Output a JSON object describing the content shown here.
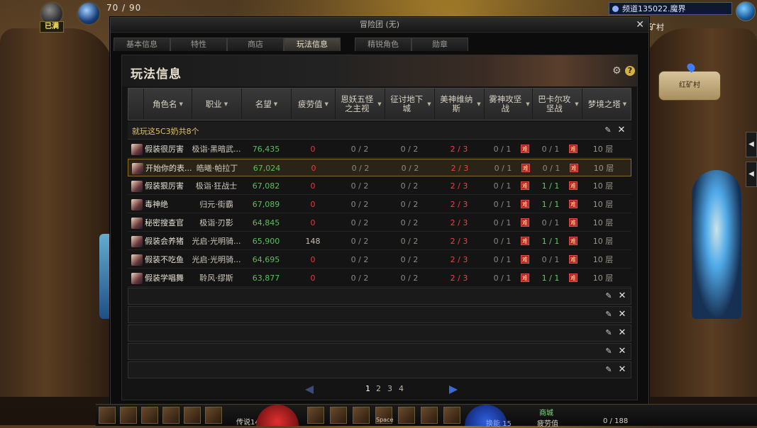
{
  "hud": {
    "status_label": "已满",
    "hp_text": "70 / 90",
    "channel": "频道135022.魔界",
    "town": "矿村",
    "minimap_label": "红矿村",
    "bottom": {
      "legend_label": "传说14",
      "stamina_label": "疲劳值",
      "stamina_value": "0 / 188",
      "swap_label": "换能",
      "swap_value": "15",
      "mall_label": "商城",
      "space_label": "Space"
    }
  },
  "dialog": {
    "title": "冒险团 (无)",
    "tabs": [
      "基本信息",
      "特性",
      "商店",
      "玩法信息",
      "精锐角色",
      "勋章"
    ],
    "active_tab": 3,
    "panel_title": "玩法信息",
    "columns": [
      "角色名",
      "职业",
      "名望",
      "疲劳值",
      "恩妖五怪之主视",
      "征讨地下城",
      "美神维纳斯",
      "雾神攻坚战",
      "巴卡尔攻坚战",
      "梦境之塔"
    ],
    "group_label": "就玩这5C3奶共8个",
    "hard_badge": "难",
    "rows": [
      {
        "name": "假装很厉害",
        "job": "极诣·黑暗武...",
        "fame": "76,435",
        "fatigue": "0",
        "a": "0 / 2",
        "b": "0 / 2",
        "c": "2 / 3",
        "d": "0 / 1",
        "e": "0 / 1",
        "f": "10 层"
      },
      {
        "name": "开始你的表...",
        "job": "皓曦·帕拉丁",
        "fame": "67,024",
        "fatigue": "0",
        "a": "0 / 2",
        "b": "0 / 2",
        "c": "2 / 3",
        "d": "0 / 1",
        "e": "0 / 1",
        "f": "10 层"
      },
      {
        "name": "假装狠厉害",
        "job": "极诣·狂战士",
        "fame": "67,082",
        "fatigue": "0",
        "a": "0 / 2",
        "b": "0 / 2",
        "c": "2 / 3",
        "d": "0 / 1",
        "e": "1 / 1",
        "f": "10 层"
      },
      {
        "name": "毒神绝",
        "job": "归元·街霸",
        "fame": "67,089",
        "fatigue": "0",
        "a": "0 / 2",
        "b": "0 / 2",
        "c": "2 / 3",
        "d": "0 / 1",
        "e": "1 / 1",
        "f": "10 层"
      },
      {
        "name": "秘密搜查官",
        "job": "极诣·刃影",
        "fame": "64,845",
        "fatigue": "0",
        "a": "0 / 2",
        "b": "0 / 2",
        "c": "2 / 3",
        "d": "0 / 1",
        "e": "0 / 1",
        "f": "10 层"
      },
      {
        "name": "假装会养猪",
        "job": "光启·光明骑...",
        "fame": "65,900",
        "fatigue": "148",
        "a": "0 / 2",
        "b": "0 / 2",
        "c": "2 / 3",
        "d": "0 / 1",
        "e": "1 / 1",
        "f": "10 层"
      },
      {
        "name": "假装不吃鱼",
        "job": "光启·光明骑...",
        "fame": "64,695",
        "fatigue": "0",
        "a": "0 / 2",
        "b": "0 / 2",
        "c": "2 / 3",
        "d": "0 / 1",
        "e": "0 / 1",
        "f": "10 层"
      },
      {
        "name": "假装学唱舞",
        "job": "聆风·缪斯",
        "fame": "63,877",
        "fatigue": "0",
        "a": "0 / 2",
        "b": "0 / 2",
        "c": "2 / 3",
        "d": "0 / 1",
        "e": "1 / 1",
        "f": "10 层"
      }
    ],
    "pages": [
      "1",
      "2",
      "3",
      "4"
    ],
    "current_page": "1"
  },
  "icons": {
    "edit": "pencil-icon",
    "delete": "close-icon",
    "settings": "gear-icon",
    "help": "help-icon"
  }
}
